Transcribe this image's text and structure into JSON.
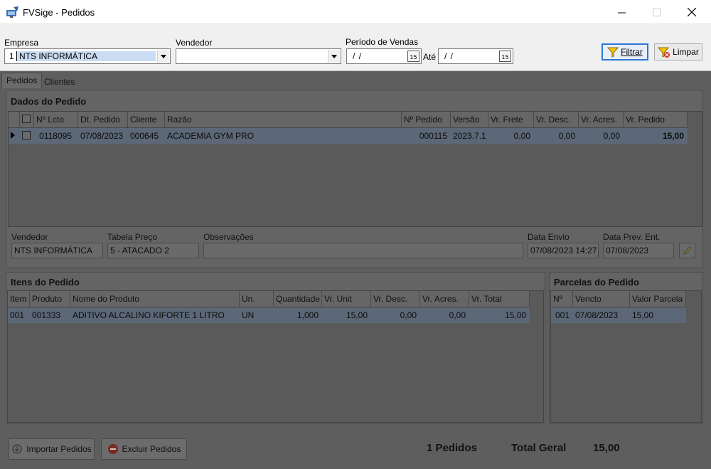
{
  "window": {
    "title": "FVSige - Pedidos"
  },
  "filters": {
    "empresa_label": "Empresa",
    "empresa_code": "1",
    "empresa_value": "NTS INFORMÁTICA",
    "vendedor_label": "Vendedor",
    "vendedor_value": "",
    "periodo_label": "Período de Vendas",
    "periodo_from": "/ /",
    "ate_label": "Até",
    "periodo_to": "/ /",
    "calendar_icon_text": "15",
    "filtrar_label": "Filtrar",
    "limpar_label": "Limpar"
  },
  "tabs": [
    "Pedidos",
    "Clientes"
  ],
  "dados": {
    "title": "Dados do Pedido",
    "columns": [
      "Nº Lcto",
      "Dt. Pedido",
      "Cliente",
      "Razão",
      "Nº Pedido",
      "Versão",
      "Vr. Frete",
      "Vr. Desc.",
      "Vr. Acres.",
      "Vr. Pedido"
    ],
    "rows": [
      {
        "lcto": "0118095",
        "dt": "07/08/2023",
        "cliente": "000645",
        "razao": "ACADEMIA GYM PRO",
        "pedido": "000115",
        "versao": "2023.7.1",
        "frete": "0,00",
        "desc": "0,00",
        "acres": "0,00",
        "valor": "15,00"
      }
    ]
  },
  "detalhes": {
    "vendedor_label": "Vendedor",
    "vendedor_value": "NTS INFORMÁTICA",
    "tabela_label": "Tabela Preço",
    "tabela_value": "5 - ATACADO 2",
    "obs_label": "Observações",
    "obs_value": "",
    "envio_label": "Data Envio",
    "envio_value": "07/08/2023 14:27",
    "prev_label": "Data Prev. Ent.",
    "prev_value": "07/08/2023"
  },
  "itens": {
    "title": "Itens do Pedido",
    "columns": [
      "Item",
      "Produto",
      "Nome do Produto",
      "Un.",
      "Quantidade",
      "Vr. Unit",
      "Vr. Desc.",
      "Vr. Acres.",
      "Vr. Total"
    ],
    "rows": [
      {
        "item": "001",
        "produto": "001333",
        "nome": "ADITIVO ALCALINO KIFORTE 1 LITRO",
        "un": "UN",
        "qtd": "1,000",
        "unit": "15,00",
        "desc": "0,00",
        "acres": "0,00",
        "total": "15,00"
      }
    ]
  },
  "parcelas": {
    "title": "Parcelas do Pedido",
    "columns": [
      "Nº",
      "Vencto",
      "Valor Parcela"
    ],
    "rows": [
      {
        "n": "001",
        "vencto": "07/08/2023",
        "valor": "15,00"
      }
    ]
  },
  "footer": {
    "importar_label": "Importar Pedidos",
    "excluir_label": "Excluir Pedidos",
    "pedidos_count": "1 Pedidos",
    "total_label": "Total Geral",
    "total_value": "15,00"
  },
  "colors": {
    "accent": "#2b78d4",
    "overlay": "#5e5e5e"
  }
}
